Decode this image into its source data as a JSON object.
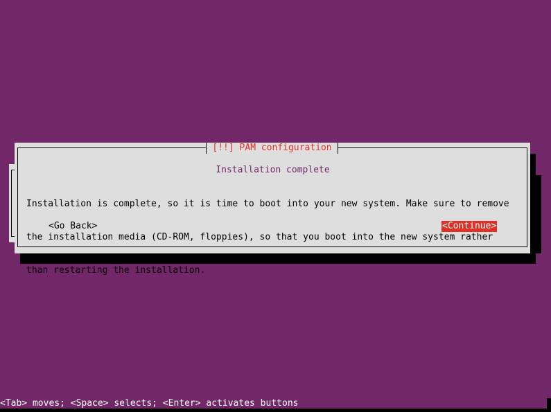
{
  "dialog": {
    "title": "[!!] PAM configuration",
    "heading": "Installation complete",
    "body_lines": [
      "Installation is complete, so it is time to boot into your new system. Make sure to remove",
      "the installation media (CD-ROM, floppies), so that you boot into the new system rather",
      "than restarting the installation."
    ],
    "buttons": {
      "go_back": "<Go Back>",
      "continue": "<Continue>"
    }
  },
  "status_bar": {
    "hint": "<Tab> moves; <Space> selects; <Enter> activates buttons"
  },
  "colors": {
    "background": "#722768",
    "dialog": "#dedede",
    "accent": "#e03128",
    "heading": "#722768"
  }
}
